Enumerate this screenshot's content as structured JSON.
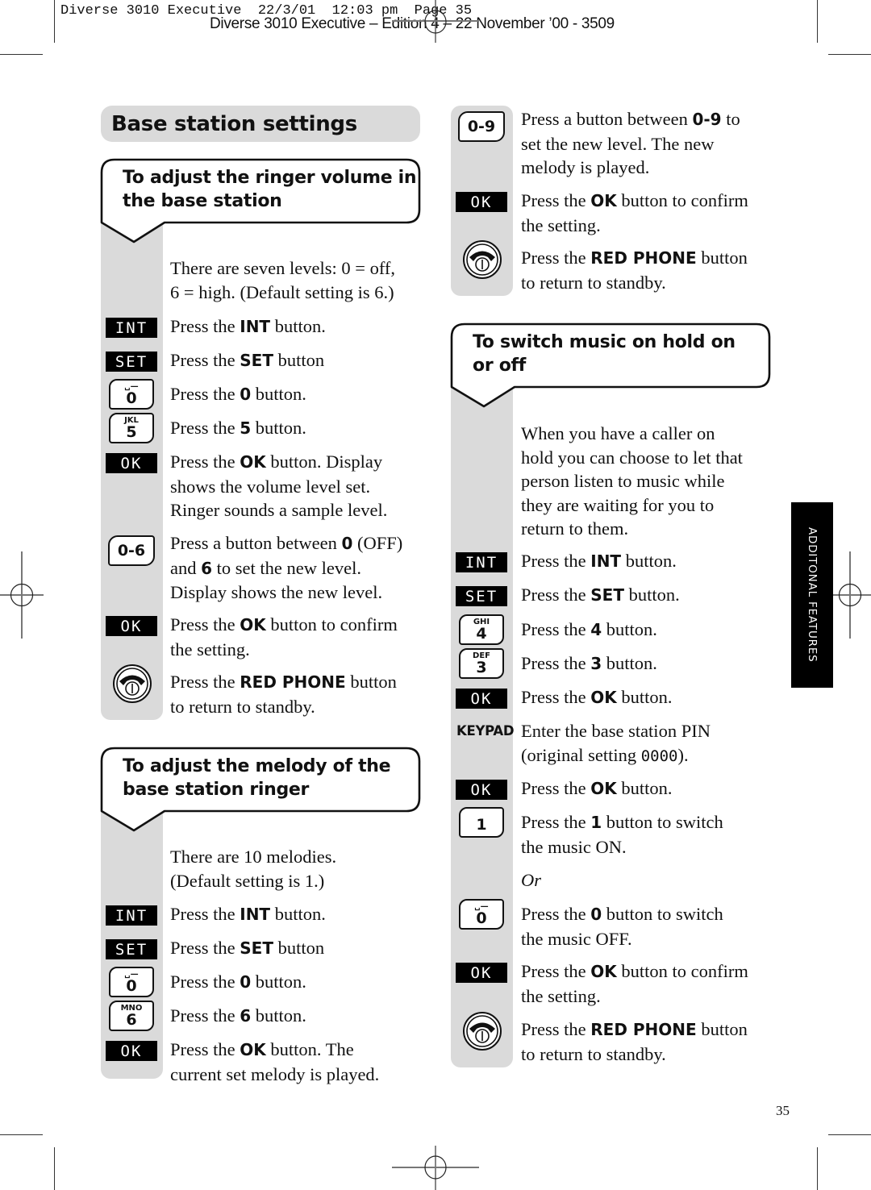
{
  "print_header": {
    "slug": "Diverse 3010 Executive  22/3/01  12:03 pm  Page 35",
    "edition": "Diverse 3010 Executive – Edition 4 – 22 November ’00 - 3509"
  },
  "page_title": "Base station settings",
  "side_tab": "ADDITONAL FEATURES",
  "page_number": "35",
  "sections": {
    "ringer_volume": {
      "heading_line1": "To adjust the ringer volume in",
      "heading_line2": "the base station",
      "intro": "There are seven levels: 0 = off,\n6 = high. (Default setting is 6.)",
      "steps": [
        {
          "key": "INT",
          "icon": "int-key-icon",
          "pre": "Press the ",
          "bold": "INT",
          "post": " button."
        },
        {
          "key": "SET",
          "icon": "set-key-icon",
          "pre": "Press the ",
          "bold": "SET",
          "post": " button"
        },
        {
          "key": "0",
          "sub": "␣—",
          "icon": "zero-key-icon",
          "pre": "Press the ",
          "bold": "0",
          "post": " button."
        },
        {
          "key": "5",
          "sub": "JKL",
          "icon": "five-key-icon",
          "pre": "Press the ",
          "bold": "5",
          "post": " button."
        },
        {
          "key": "OK",
          "icon": "ok-key-icon",
          "pre": "Press the ",
          "bold": "OK",
          "post": " button. Display\nshows the volume level set.\nRinger sounds a sample level."
        },
        {
          "key": "0-6",
          "icon": "range-key-icon",
          "pre": "Press a button between ",
          "bold": "0",
          "post": " (OFF)\nand ",
          "bold2": "6",
          "post2": " to set the new level.\nDisplay shows the new level."
        },
        {
          "key": "OK",
          "icon": "ok-key-icon",
          "pre": "Press the ",
          "bold": "OK",
          "post": " button to confirm\nthe setting."
        },
        {
          "key": "RED PHONE",
          "icon": "red-phone-key-icon",
          "pre": "Press the ",
          "bold": "RED PHONE",
          "post": " button\nto return to standby."
        }
      ]
    },
    "melody": {
      "heading_line1": "To adjust the melody of the",
      "heading_line2": "base station ringer",
      "intro": "There are 10 melodies.\n(Default setting is 1.)",
      "steps": [
        {
          "key": "INT",
          "icon": "int-key-icon",
          "pre": "Press the ",
          "bold": "INT",
          "post": " button."
        },
        {
          "key": "SET",
          "icon": "set-key-icon",
          "pre": "Press the ",
          "bold": "SET",
          "post": " button"
        },
        {
          "key": "0",
          "sub": "␣—",
          "icon": "zero-key-icon",
          "pre": "Press the ",
          "bold": "0",
          "post": " button."
        },
        {
          "key": "6",
          "sub": "MNO",
          "icon": "six-key-icon",
          "pre": "Press the ",
          "bold": "6",
          "post": " button."
        },
        {
          "key": "OK",
          "icon": "ok-key-icon",
          "pre": "Press the ",
          "bold": "OK",
          "post": " button. The\ncurrent set melody is played."
        },
        {
          "key": "0-9",
          "icon": "range-key-icon",
          "pre": "Press a button between ",
          "bold": "0-9",
          "post": " to\nset the new level. The new\nmelody is played."
        },
        {
          "key": "OK",
          "icon": "ok-key-icon",
          "pre": "Press the ",
          "bold": "OK",
          "post": " button to confirm\nthe setting."
        },
        {
          "key": "RED PHONE",
          "icon": "red-phone-key-icon",
          "pre": "Press the ",
          "bold": "RED PHONE",
          "post": " button\nto return to standby."
        }
      ]
    },
    "music_on_hold": {
      "heading_line1": "To switch music on hold on",
      "heading_line2": "or off",
      "intro": "When you have a caller on\nhold you can choose to let that\nperson listen to music while\nthey are waiting for you to\nreturn to them.",
      "or_label": "Or",
      "steps": [
        {
          "key": "INT",
          "icon": "int-key-icon",
          "pre": "Press the ",
          "bold": "INT",
          "post": " button."
        },
        {
          "key": "SET",
          "icon": "set-key-icon",
          "pre": "Press the ",
          "bold": "SET",
          "post": " button."
        },
        {
          "key": "4",
          "sub": "GHI",
          "icon": "four-key-icon",
          "pre": "Press the ",
          "bold": "4",
          "post": " button."
        },
        {
          "key": "3",
          "sub": "DEF",
          "icon": "three-key-icon",
          "pre": "Press the ",
          "bold": "3",
          "post": " button."
        },
        {
          "key": "OK",
          "icon": "ok-key-icon",
          "pre": "Press the ",
          "bold": "OK",
          "post": " button."
        },
        {
          "key": "KEYPAD",
          "icon": "keypad-label",
          "pre": "Enter the base station PIN\n(original setting ",
          "mono": "0000",
          "post": ")."
        },
        {
          "key": "OK",
          "icon": "ok-key-icon",
          "pre": "Press the ",
          "bold": "OK",
          "post": " button."
        },
        {
          "key": "1",
          "icon": "one-key-icon",
          "pre": "Press the ",
          "bold": "1",
          "post": " button to switch\nthe music ON."
        },
        {
          "key": "0",
          "sub": "␣—",
          "icon": "zero-key-icon",
          "pre": "Press the ",
          "bold": "0",
          "post": " button to switch\nthe music OFF."
        },
        {
          "key": "OK",
          "icon": "ok-key-icon",
          "pre": "Press the ",
          "bold": "OK",
          "post": " button to confirm\nthe setting."
        },
        {
          "key": "RED PHONE",
          "icon": "red-phone-key-icon",
          "pre": "Press the ",
          "bold": "RED PHONE",
          "post": " button\nto return to standby."
        }
      ]
    }
  }
}
